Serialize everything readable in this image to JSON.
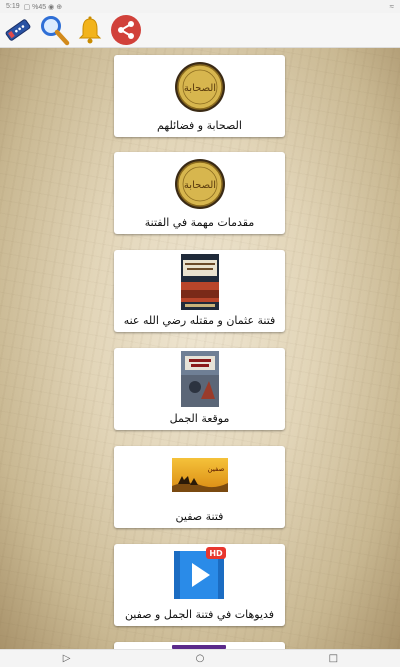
{
  "status": {
    "time": "5:19",
    "extras": "▢ %45 ◉ ⊕",
    "wifi": "≈"
  },
  "toolbar": {
    "icons": [
      "remote-icon",
      "search-icon",
      "bell-icon",
      "share-icon"
    ],
    "accent": "#d1413a"
  },
  "cards": [
    {
      "label": "الصحابة و فضائلهم",
      "thumb_text": "الصحابة"
    },
    {
      "label": "مقدمات مهمة في الفتنة",
      "thumb_text": "الصحابة"
    },
    {
      "label": "فتنة عثمان و مقتله رضي الله عنه"
    },
    {
      "label": "موقعة الجمل"
    },
    {
      "label": "فتنة صفين",
      "thumb_text": "صفين"
    },
    {
      "label": "فديوهات في فتنة الجمل و صفين",
      "badge": "HD"
    }
  ],
  "nav": {
    "back": "▷",
    "home": "○",
    "recents": "□"
  }
}
